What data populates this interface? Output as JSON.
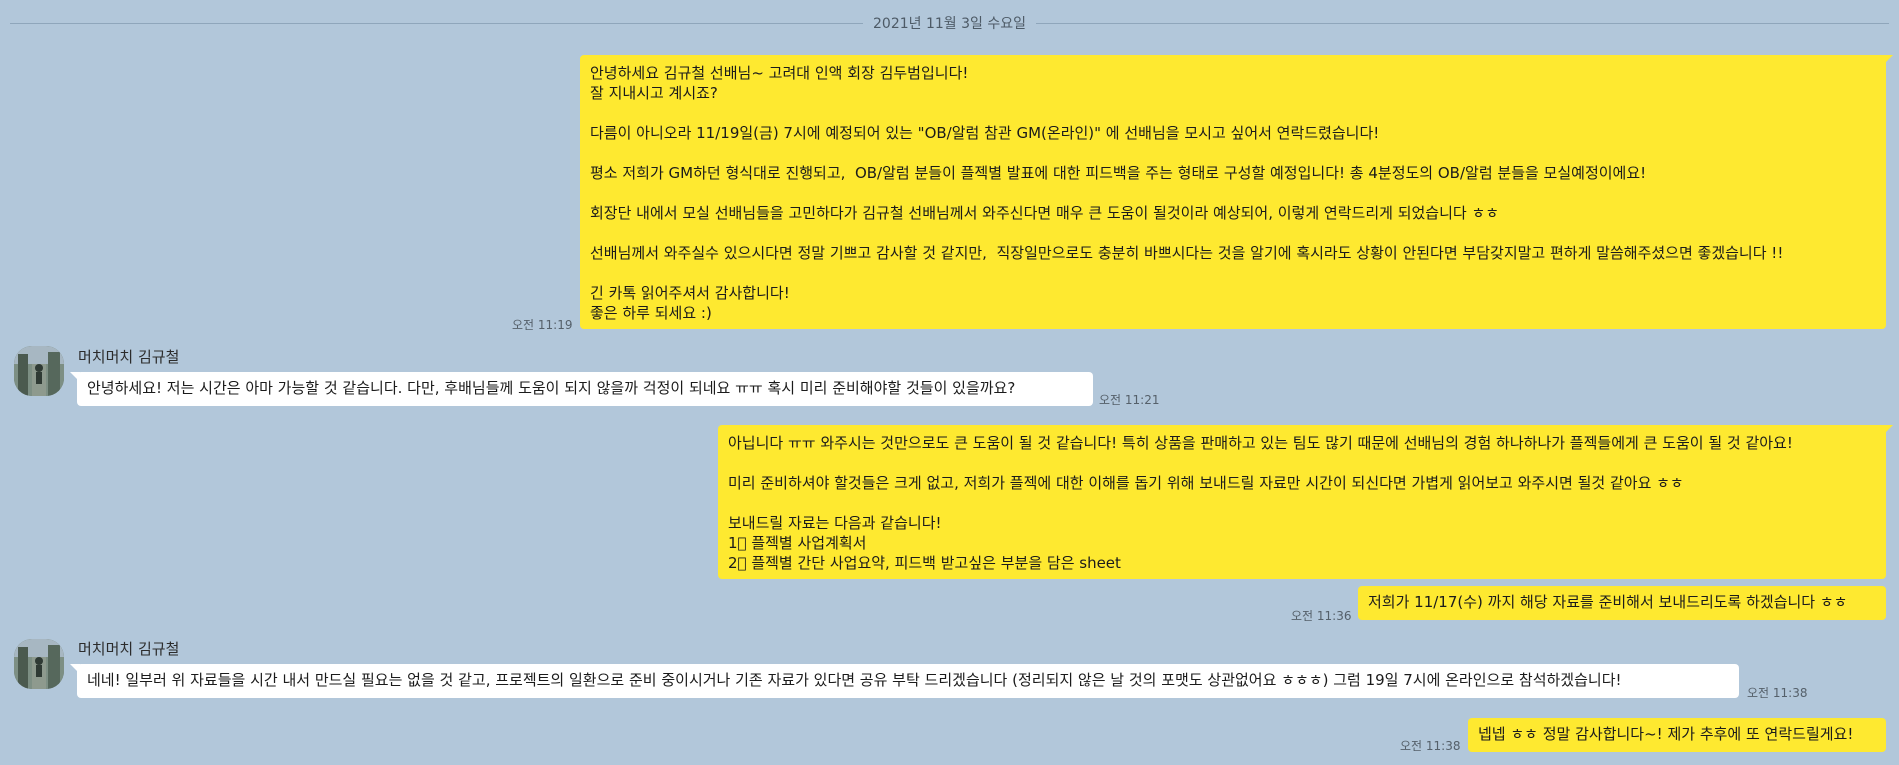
{
  "date_divider": "2021년 11월 3일 수요일",
  "messages": [
    {
      "from": "me",
      "time": "오전 11:19",
      "text": "안녕하세요 김규철 선배님~ 고려대 인액 회장 김두범입니다!\n잘 지내시고 계시죠?\n\n다름이 아니오라 11/19일(금) 7시에 예정되어 있는 \"OB/알럼 참관 GM(온라인)\" 에 선배님을 모시고 싶어서 연락드렸습니다!\n\n평소 저희가 GM하던 형식대로 진행되고,  OB/알럼 분들이 플젝별 발표에 대한 피드백을 주는 형태로 구성할 예정입니다! 총 4분정도의 OB/알럼 분들을 모실예정이에요!\n\n회장단 내에서 모실 선배님들을 고민하다가 김규철 선배님께서 와주신다면 매우 큰 도움이 될것이라 예상되어, 이렇게 연락드리게 되었습니다 ㅎㅎ\n\n선배님께서 와주실수 있으시다면 정말 기쁘고 감사할 것 같지만,  직장일만으로도 충분히 바쁘시다는 것을 알기에 혹시라도 상황이 안된다면 부담갖지말고 편하게 말씀해주셨으면 좋겠습니다 !!\n\n긴 카톡 읽어주셔서 감사합니다!\n좋은 하루 되세요 :)"
    },
    {
      "from": "other",
      "sender": "머치머치 김규철",
      "time": "오전 11:21",
      "text": "안녕하세요! 저는 시간은 아마 가능할 것 같습니다. 다만, 후배님들께 도움이 되지 않을까 걱정이 되네요 ㅠㅠ 혹시 미리 준비해야할 것들이 있을까요?"
    },
    {
      "from": "me",
      "time": "",
      "text": "아닙니다 ㅠㅠ 와주시는 것만으로도 큰 도움이 될 것 같습니다! 특히 상품을 판매하고 있는 팀도 많기 때문에 선배님의 경험 하나하나가 플젝들에게 큰 도움이 될 것 같아요!\n\n미리 준비하셔야 할것들은 크게 없고, 저희가 플젝에 대한 이해를 돕기 위해 보내드릴 자료만 시간이 되신다면 가볍게 읽어보고 와주시면 될것 같아요 ㅎㅎ\n\n보내드릴 자료는 다음과 같습니다!\n1⃣ 플젝별 사업계획서\n2⃣ 플젝별 간단 사업요약, 피드백 받고싶은 부분을 담은 sheet"
    },
    {
      "from": "me",
      "time": "오전 11:36",
      "text": "저희가 11/17(수) 까지 해당 자료를 준비해서 보내드리도록 하겠습니다 ㅎㅎ"
    },
    {
      "from": "other",
      "sender": "머치머치 김규철",
      "time": "오전 11:38",
      "text": "네네! 일부러 위 자료들을 시간 내서 만드실 필요는 없을 것 같고, 프로젝트의 일환으로 준비 중이시거나 기존 자료가 있다면 공유 부탁 드리겠습니다 (정리되지 않은 날 것의 포맷도 상관없어요 ㅎㅎㅎ) 그럼 19일 7시에 온라인으로 참석하겠습니다!"
    },
    {
      "from": "me",
      "time": "오전 11:38",
      "text": "넵넵 ㅎㅎ 정말 감사합니다~! 제가 추후에 또 연락드릴게요!"
    }
  ]
}
